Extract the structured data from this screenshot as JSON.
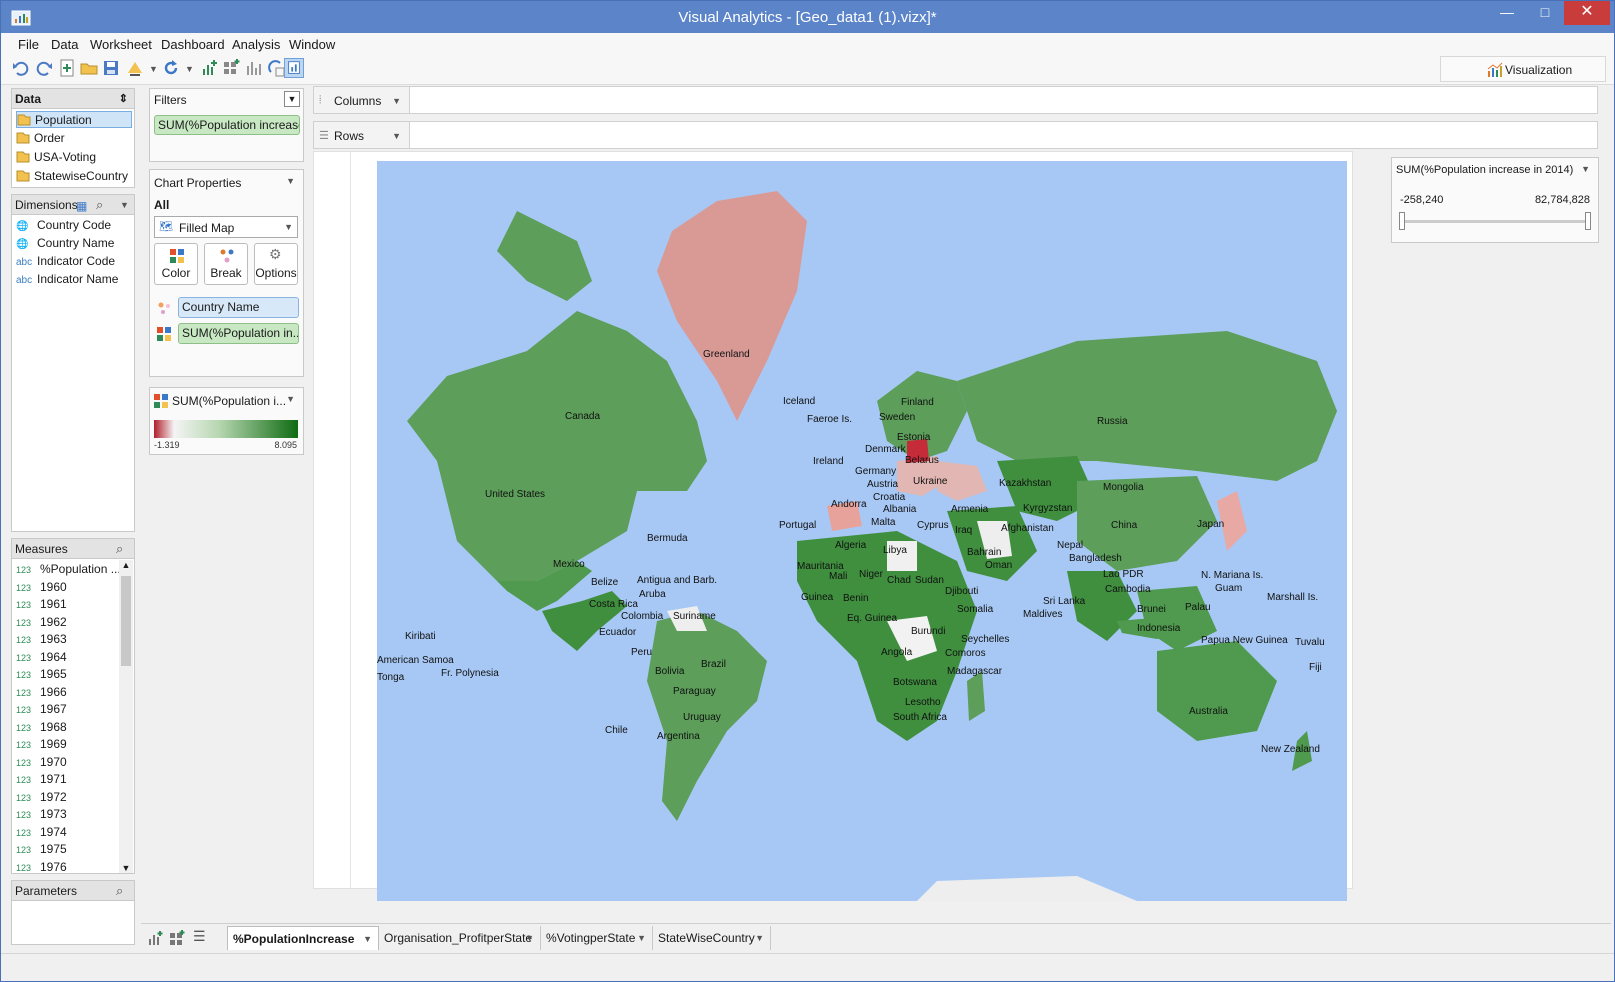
{
  "window": {
    "title": "Visual Analytics - [Geo_data1 (1).vizx]*",
    "minimize": "—",
    "maximize": "□",
    "close": "✕"
  },
  "menu": [
    "File",
    "Data",
    "Worksheet",
    "Dashboard",
    "Analysis",
    "Window"
  ],
  "toolbar": {
    "visualization_label": "Visualization"
  },
  "data_panel": {
    "title": "Data",
    "sources": [
      "Population",
      "Order",
      "USA-Voting",
      "StatewiseCountry"
    ]
  },
  "dimensions": {
    "title": "Dimensions",
    "items": [
      {
        "label": "Country Code",
        "type": "geo"
      },
      {
        "label": "Country Name",
        "type": "geo"
      },
      {
        "label": "Indicator Code",
        "type": "abc"
      },
      {
        "label": "Indicator Name",
        "type": "abc"
      }
    ],
    "abc": "abc"
  },
  "measures": {
    "title": "Measures",
    "first": "%Population ...",
    "type_label": "123",
    "years": [
      "1960",
      "1961",
      "1962",
      "1963",
      "1964",
      "1965",
      "1966",
      "1967",
      "1968",
      "1969",
      "1970",
      "1971",
      "1972",
      "1973",
      "1974",
      "1975",
      "1976"
    ]
  },
  "parameters": {
    "title": "Parameters"
  },
  "filters": {
    "title": "Filters",
    "pill": "SUM(%Population increase..."
  },
  "chart_properties": {
    "title": "Chart Properties",
    "scope": "All",
    "chart_type": "Filled Map",
    "buttons": {
      "color": "Color",
      "break": "Break",
      "options": "Options"
    },
    "break_field": "Country Name",
    "color_field": "SUM(%Population in..."
  },
  "legend": {
    "title": "SUM(%Population i...",
    "min": "-1.319",
    "max": "8.095",
    "color_low": "#b01e2a",
    "color_high": "#0f6b12"
  },
  "shelves": {
    "columns": "Columns",
    "rows": "Rows"
  },
  "filter_card": {
    "title": "SUM(%Population increase in 2014)",
    "min": "-258,240",
    "max": "82,784,828"
  },
  "map": {
    "ocean": "#a7c8f4",
    "land": "#5c9e5a",
    "labels": [
      "Greenland",
      "Canada",
      "United States",
      "Bermuda",
      "Mexico",
      "Belize",
      "Antigua and Barb.",
      "Aruba",
      "Costa Rica",
      "Colombia",
      "Suriname",
      "Ecuador",
      "Peru",
      "Brazil",
      "Bolivia",
      "Paraguay",
      "Uruguay",
      "Argentina",
      "Chile",
      "Kiribati",
      "American Samoa",
      "Tonga",
      "Fr. Polynesia",
      "Iceland",
      "Faeroe Is.",
      "Finland",
      "Sweden",
      "Estonia",
      "Denmark",
      "Belarus",
      "Ireland",
      "Germany",
      "Austria",
      "Ukraine",
      "Croatia",
      "Albania",
      "Andorra",
      "Malta",
      "Portugal",
      "Armenia",
      "Cyprus",
      "Iraq",
      "Bahrain",
      "Oman",
      "Algeria",
      "Libya",
      "Mauritania",
      "Mali",
      "Niger",
      "Chad",
      "Sudan",
      "Djibouti",
      "Guinea",
      "Benin",
      "Eq. Guinea",
      "Somalia",
      "Burundi",
      "Seychelles",
      "Angola",
      "Comoros",
      "Madagascar",
      "Botswana",
      "Lesotho",
      "South Africa",
      "Russia",
      "Kazakhstan",
      "Mongolia",
      "Kyrgyzstan",
      "Afghanistan",
      "China",
      "Nepal",
      "Bangladesh",
      "Lao PDR",
      "Cambodia",
      "Sri Lanka",
      "Maldives",
      "Brunei",
      "Indonesia",
      "Palau",
      "N. Mariana Is.",
      "Guam",
      "Marshall Is.",
      "Papua New Guinea",
      "Tuvalu",
      "Fiji",
      "Australia",
      "New Zealand",
      "Japan"
    ]
  },
  "tabs": [
    "%PopulationIncrease",
    "Organisation_ProfitperState",
    "%VotingperState",
    "StateWiseCountry"
  ]
}
